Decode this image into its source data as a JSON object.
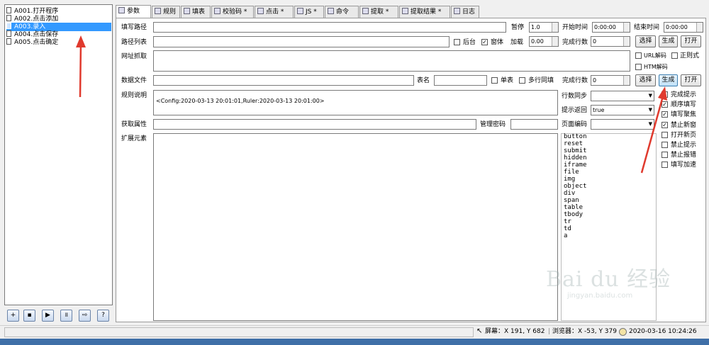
{
  "tree": {
    "items": [
      {
        "label": "A001.打开程序",
        "selected": false
      },
      {
        "label": "A002.点击添加",
        "selected": false
      },
      {
        "label": "A003.录入",
        "selected": true
      },
      {
        "label": "A004.点击保存",
        "selected": false
      },
      {
        "label": "A005.点击确定",
        "selected": false
      }
    ]
  },
  "left_toolbar": {
    "buttons": [
      {
        "name": "add-icon",
        "glyph": "+"
      },
      {
        "name": "save-icon",
        "glyph": "▪"
      },
      {
        "name": "play-icon",
        "glyph": "▶"
      },
      {
        "name": "pause-icon",
        "glyph": "॥"
      },
      {
        "name": "export-icon",
        "glyph": "⇨"
      },
      {
        "name": "help-icon",
        "glyph": "?"
      }
    ]
  },
  "tabs": [
    {
      "label": "参数",
      "active": true
    },
    {
      "label": "规则",
      "active": false
    },
    {
      "label": "填表",
      "active": false
    },
    {
      "label": "校验码 *",
      "active": false
    },
    {
      "label": "点击 *",
      "active": false
    },
    {
      "label": "JS *",
      "active": false
    },
    {
      "label": "命令",
      "active": false
    },
    {
      "label": "提取 *",
      "active": false
    },
    {
      "label": "提取结果 *",
      "active": false
    },
    {
      "label": "日志",
      "active": false
    }
  ],
  "form": {
    "fill_path_label": "填写路径",
    "pause_label": "暂停",
    "pause_value": "1.0",
    "start_time_label": "开始时间",
    "start_time_value": "0:00:00",
    "end_time_label": "结束时间",
    "end_time_value": "0:00:00",
    "path_list_label": "路径列表",
    "background_label": "后台",
    "background_checked": false,
    "form_label": "窗体",
    "form_checked": true,
    "load_label": "加载",
    "load_value": "0.00",
    "complete_rows_label": "完成行数",
    "complete_rows_value": "0",
    "select_label": "选择",
    "generate_label": "生成",
    "open_label": "打开",
    "url_fetch_label": "网址抓取",
    "url_decode_label": "URL解码",
    "url_decode_checked": false,
    "regex_label": "正则式",
    "regex_checked": false,
    "htm_decode_label": "HTM解码",
    "htm_decode_checked": false,
    "data_file_label": "数据文件",
    "table_name_label": "表名",
    "single_table_label": "单表",
    "single_table_checked": false,
    "multi_row_label": "多行同填",
    "multi_row_checked": false,
    "complete_rows2_value": "0",
    "rule_desc_label": "规则说明",
    "rule_desc_value": "<Config:2020-03-13 20:01:01,Ruler:2020-03-13 20:01:00>",
    "param_sync_label": "行数同步",
    "param_sync_value": "",
    "prompt_return_label": "提示返回",
    "prompt_return_value": "true",
    "get_attr_label": "获取属性",
    "admin_pwd_label": "管理密码",
    "page_encoding_label": "页面编码",
    "page_encoding_value": "",
    "ext_elements_label": "扩展元素"
  },
  "options": [
    {
      "label": "完成提示",
      "checked": false
    },
    {
      "label": "顺序填写",
      "checked": true
    },
    {
      "label": "填写聚焦",
      "checked": true
    },
    {
      "label": "禁止新窗",
      "checked": true
    },
    {
      "label": "打开新页",
      "checked": false
    },
    {
      "label": "禁止提示",
      "checked": false
    },
    {
      "label": "禁止报错",
      "checked": false
    },
    {
      "label": "填写加速",
      "checked": false
    }
  ],
  "element_tags": [
    "button",
    "reset",
    "submit",
    "hidden",
    "iframe",
    "file",
    "img",
    "object",
    "div",
    "span",
    "table",
    "tbody",
    "tr",
    "td",
    "a"
  ],
  "status": {
    "screen": "屏幕：X 191, Y 682",
    "browser": "浏览器：X -53, Y 379",
    "datetime": "2020-03-16 10:24:26"
  },
  "watermark": {
    "text": "Bai du 经验",
    "sub": "jingyan.baidu.com"
  },
  "colors": {
    "selection": "#3399ff",
    "arrow": "#e03a2e",
    "taskbar": "#3f6fa7"
  }
}
